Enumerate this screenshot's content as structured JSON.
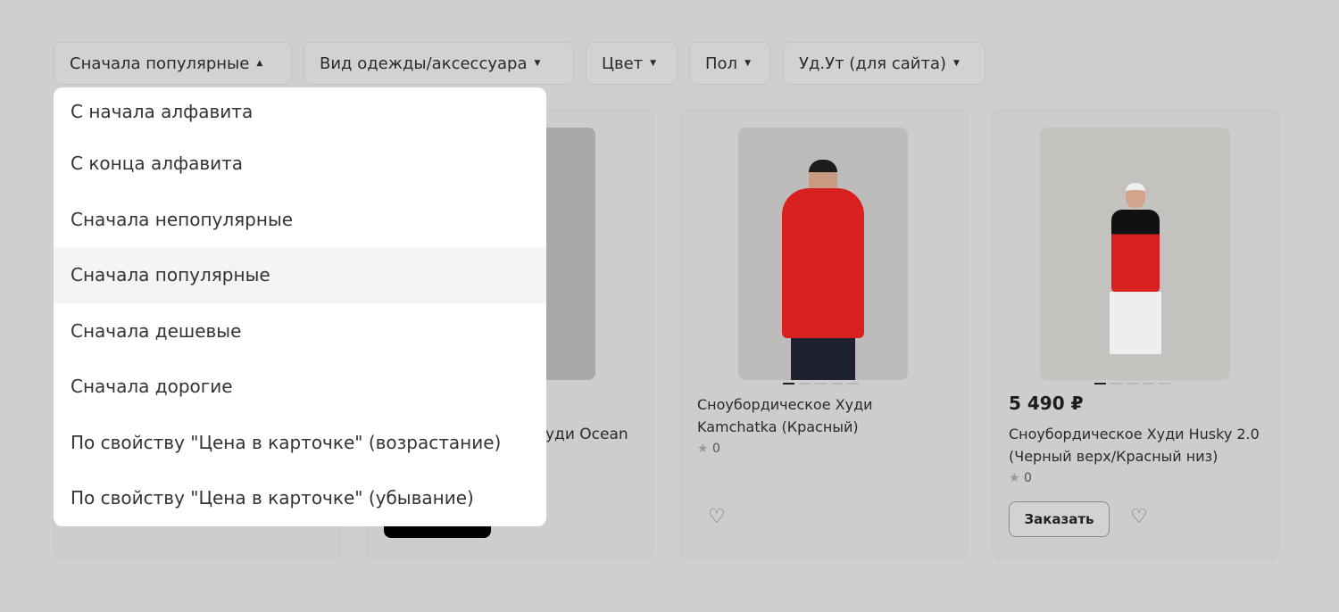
{
  "filters": [
    {
      "label": "Сначала популярные",
      "icon": "triangle-up-icon",
      "open": true
    },
    {
      "label": "Вид одежды/аксессуара",
      "icon": "triangle-down-icon"
    },
    {
      "label": "Цвет",
      "icon": "triangle-down-icon"
    },
    {
      "label": "Пол",
      "icon": "triangle-down-icon"
    },
    {
      "label": "Уд.Ут (для сайта)",
      "icon": "triangle-down-icon"
    }
  ],
  "sort_options": [
    "С начала алфавита",
    "С конца алфавита",
    "Сначала непопулярные",
    "Сначала популярные",
    "Сначала дешевые",
    "Сначала дорогие",
    "По свойству \"Цена в карточке\" (возрастание)",
    "По свойству \"Цена в карточке\" (убывание)"
  ],
  "sort_selected": "Сначала популярные",
  "products": [
    {
      "title_fragment": "уди Ocean"
    },
    {
      "title": "Сноубордическое Худи Kamchatka (Красный)",
      "rating": "0"
    },
    {
      "price": "5 490 ₽",
      "title": "Сноубордическое Худи Husky 2.0 (Черный верх/Красный низ)",
      "rating": "0",
      "order_label": "Заказать"
    }
  ],
  "colors": {
    "overlay": "#cfcfcf",
    "product_red": "#d8201f"
  }
}
